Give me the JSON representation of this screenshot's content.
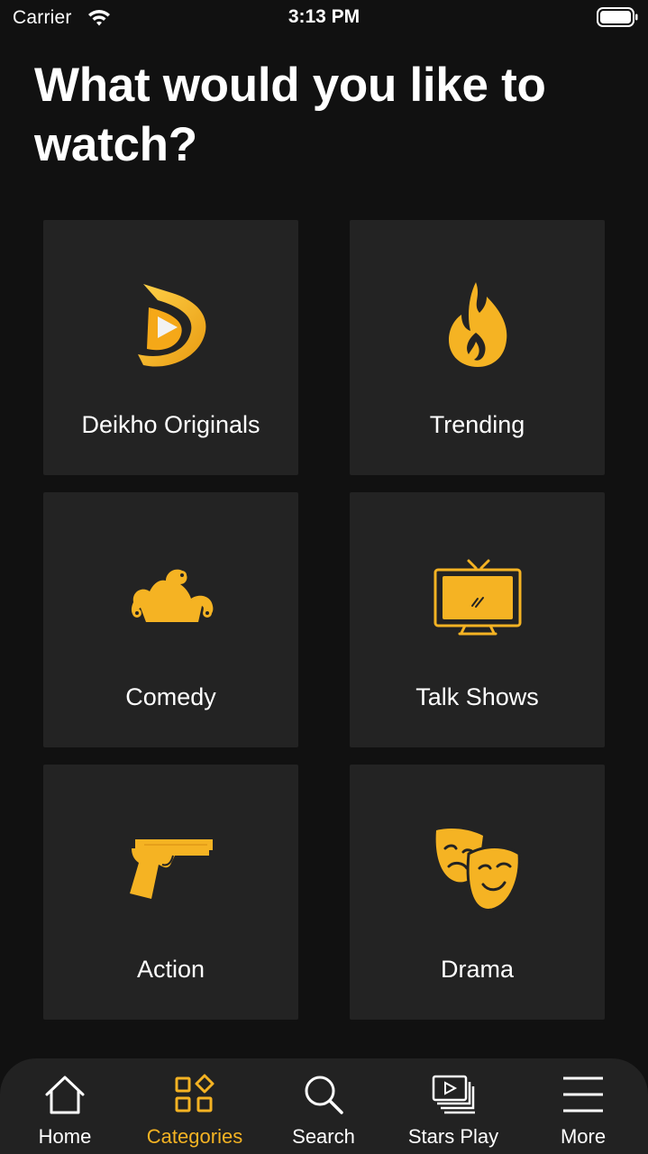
{
  "status_bar": {
    "carrier": "Carrier",
    "time": "3:13 PM"
  },
  "title": "What would you like to watch?",
  "colors": {
    "accent": "#f5b323",
    "background": "#111111",
    "tile": "#232323",
    "tab_bar": "#222222"
  },
  "categories": [
    {
      "label": "Deikho Originals",
      "icon": "deikho-logo-icon"
    },
    {
      "label": "Trending",
      "icon": "flame-icon"
    },
    {
      "label": "Comedy",
      "icon": "jester-hat-icon"
    },
    {
      "label": "Talk Shows",
      "icon": "tv-icon"
    },
    {
      "label": "Action",
      "icon": "pistol-icon"
    },
    {
      "label": "Drama",
      "icon": "theater-masks-icon"
    }
  ],
  "tabs": [
    {
      "label": "Home",
      "icon": "home-icon",
      "active": false
    },
    {
      "label": "Categories",
      "icon": "categories-icon",
      "active": true
    },
    {
      "label": "Search",
      "icon": "search-icon",
      "active": false
    },
    {
      "label": "Stars Play",
      "icon": "stars-play-icon",
      "active": false
    },
    {
      "label": "More",
      "icon": "menu-icon",
      "active": false
    }
  ]
}
